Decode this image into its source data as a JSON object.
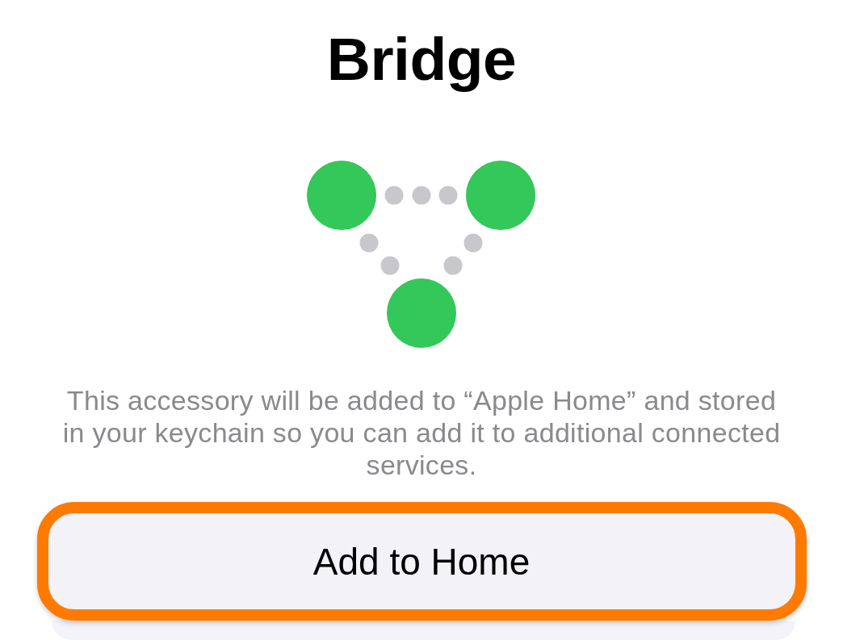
{
  "title": "Bridge",
  "description": "This accessory will be added to “Apple Home” and stored in your keychain so you can add it to additional connected services.",
  "button": {
    "label": "Add to Home",
    "highlighted": true
  }
}
